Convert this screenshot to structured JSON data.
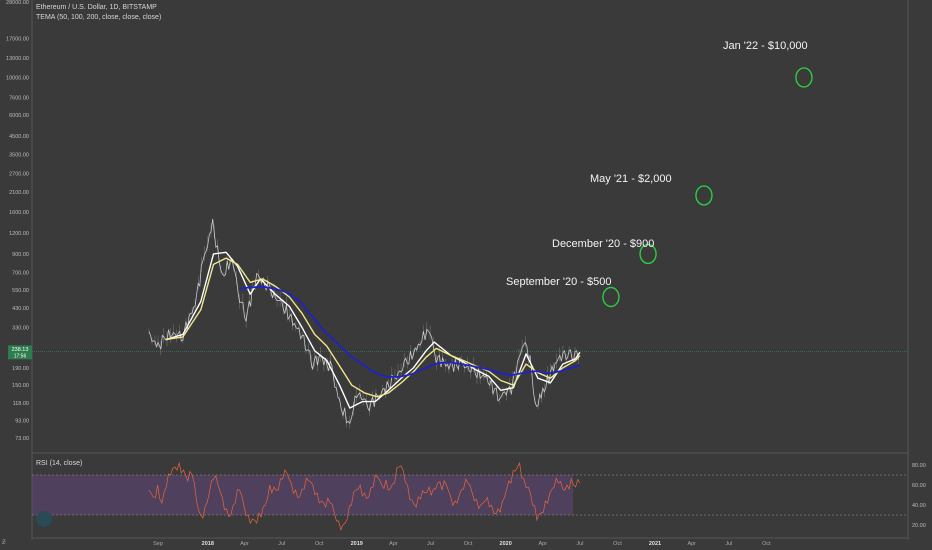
{
  "header": {
    "symbol": "Ethereum / U.S. Dollar, 1D, BITSTAMP",
    "indicator": "TEMA (50, 100, 200, close, close, close)"
  },
  "rsi": {
    "label": "RSI (14, close)"
  },
  "price_tag": {
    "value": "238.13",
    "countdown": "17:56"
  },
  "corner_glyph": "Ƶ",
  "annotations": [
    {
      "text": "Jan '22 - $10,000"
    },
    {
      "text": "May '21 - $2,000"
    },
    {
      "text": "December '20 - $900"
    },
    {
      "text": "September '20 - $500"
    }
  ],
  "colors": {
    "background": "#3a3a3a",
    "price_candles": "#e0e0e0",
    "tema_50": "#ffffff",
    "tema_100": "#f2e68a",
    "tema_200": "#1e22c8",
    "rsi_line": "#e8663a",
    "rsi_band": "#6a4a8a",
    "target_circles": "#2ecc40",
    "current_price_line": "#2e8b57"
  },
  "chart_data": [
    {
      "type": "line",
      "scale": "log",
      "y_ticks": [
        "28000.00",
        "17000.00",
        "13000.00",
        "10000.00",
        "7600.00",
        "6000.00",
        "4500.00",
        "3500.00",
        "2700.00",
        "2100.00",
        "1600.00",
        "1200.00",
        "900.00",
        "700.00",
        "550.00",
        "430.00",
        "330.00",
        "250.00",
        "190.00",
        "150.00",
        "118.00",
        "93.00",
        "73.00"
      ],
      "x_ticks": [
        "Sep",
        "2018",
        "Apr",
        "Jul",
        "Oct",
        "2019",
        "Apr",
        "Jul",
        "Oct",
        "2020",
        "Apr",
        "Jul",
        "Oct",
        "2021",
        "Apr",
        "Jul",
        "Oct"
      ],
      "series": [
        {
          "values_date": [
            "2017-08-10",
            "2017-09-01",
            "2017-09-15",
            "2017-10-01",
            "2017-11-01",
            "2017-12-01",
            "2017-12-20",
            "2018-01-13",
            "2018-02-06",
            "2018-03-01",
            "2018-03-20",
            "2018-04-05",
            "2018-05-01",
            "2018-06-01",
            "2018-07-01",
            "2018-08-01",
            "2018-09-01",
            "2018-09-15",
            "2018-10-01",
            "2018-11-01",
            "2018-11-20",
            "2018-12-15",
            "2019-01-01",
            "2019-02-01",
            "2019-03-01",
            "2019-04-01",
            "2019-05-01",
            "2019-06-01",
            "2019-06-26",
            "2019-07-15",
            "2019-08-15",
            "2019-09-15",
            "2019-10-15",
            "2019-11-15",
            "2019-12-17",
            "2020-01-15",
            "2020-02-14",
            "2020-03-01",
            "2020-03-13",
            "2020-04-01",
            "2020-05-01",
            "2020-06-01",
            "2020-06-15",
            "2020-07-01"
          ],
          "values": [
            300,
            250,
            280,
            300,
            300,
            460,
            800,
            1350,
            650,
            860,
            500,
            380,
            680,
            550,
            450,
            350,
            260,
            200,
            225,
            185,
            115,
            88,
            135,
            115,
            135,
            160,
            200,
            255,
            330,
            220,
            195,
            200,
            180,
            165,
            128,
            145,
            275,
            220,
            110,
            135,
            205,
            240,
            225,
            238
          ]
        },
        {
          "name": "TEMA 50",
          "x_date": [
            "2017-09-20",
            "2017-11-01",
            "2017-12-15",
            "2018-01-15",
            "2018-02-15",
            "2018-03-15",
            "2018-04-15",
            "2018-05-10",
            "2018-06-15",
            "2018-07-20",
            "2018-08-20",
            "2018-09-20",
            "2018-10-20",
            "2018-11-20",
            "2018-12-15",
            "2019-01-15",
            "2019-02-15",
            "2019-03-20",
            "2019-04-20",
            "2019-05-20",
            "2019-06-20",
            "2019-07-10",
            "2019-08-20",
            "2019-09-20",
            "2019-10-20",
            "2019-11-20",
            "2019-12-20",
            "2020-01-20",
            "2020-02-20",
            "2020-03-20",
            "2020-04-20",
            "2020-05-20",
            "2020-06-20",
            "2020-07-01"
          ],
          "y": [
            280,
            300,
            470,
            900,
            920,
            760,
            520,
            640,
            520,
            440,
            330,
            240,
            210,
            150,
            110,
            120,
            120,
            140,
            165,
            190,
            240,
            270,
            225,
            205,
            185,
            170,
            140,
            145,
            230,
            165,
            155,
            200,
            215,
            235
          ]
        },
        {
          "name": "TEMA 100",
          "x_date": [
            "2017-09-20",
            "2017-11-01",
            "2017-12-15",
            "2018-01-15",
            "2018-02-15",
            "2018-03-15",
            "2018-04-15",
            "2018-05-15",
            "2018-06-15",
            "2018-07-20",
            "2018-08-20",
            "2018-09-20",
            "2018-10-20",
            "2018-11-20",
            "2018-12-20",
            "2019-01-20",
            "2019-02-20",
            "2019-03-20",
            "2019-04-20",
            "2019-05-20",
            "2019-06-20",
            "2019-07-15",
            "2019-08-20",
            "2019-09-20",
            "2019-10-20",
            "2019-11-20",
            "2019-12-20",
            "2020-01-20",
            "2020-02-20",
            "2020-03-20",
            "2020-04-20",
            "2020-05-20",
            "2020-06-20",
            "2020-07-01"
          ],
          "y": [
            280,
            290,
            420,
            780,
            850,
            780,
            610,
            640,
            580,
            500,
            400,
            300,
            255,
            195,
            150,
            135,
            128,
            135,
            155,
            180,
            220,
            248,
            225,
            210,
            195,
            182,
            160,
            150,
            200,
            178,
            165,
            190,
            210,
            225
          ]
        },
        {
          "name": "TEMA 200",
          "x_date": [
            "2018-03-20",
            "2018-04-15",
            "2018-05-15",
            "2018-06-15",
            "2018-07-15",
            "2018-08-15",
            "2018-09-15",
            "2018-10-15",
            "2018-11-15",
            "2018-12-15",
            "2019-01-15",
            "2019-02-15",
            "2019-03-15",
            "2019-04-15",
            "2019-05-15",
            "2019-06-15",
            "2019-07-15",
            "2019-08-15",
            "2019-09-15",
            "2019-10-15",
            "2019-11-15",
            "2019-12-15",
            "2020-01-15",
            "2020-02-15",
            "2020-03-15",
            "2020-04-15",
            "2020-05-15",
            "2020-06-15",
            "2020-07-01"
          ],
          "y": [
            560,
            570,
            575,
            560,
            530,
            470,
            380,
            310,
            265,
            225,
            200,
            178,
            168,
            168,
            174,
            188,
            202,
            205,
            200,
            194,
            187,
            178,
            172,
            178,
            182,
            176,
            182,
            192,
            198
          ]
        }
      ]
    },
    {
      "type": "line",
      "name": "RSI (14, close)",
      "y_ticks": [
        "80.00",
        "60.00",
        "40.00",
        "20.00"
      ],
      "band": [
        30,
        70
      ],
      "x_date_range": [
        "2017-08-10",
        "2020-07-01"
      ],
      "values": [
        55,
        48,
        60,
        42,
        58,
        70,
        78,
        82,
        75,
        64,
        70,
        45,
        30,
        38,
        52,
        66,
        60,
        48,
        36,
        30,
        42,
        55,
        40,
        30,
        26,
        22,
        28,
        40,
        60,
        58,
        55,
        66,
        72,
        62,
        55,
        48,
        56,
        64,
        60,
        52,
        44,
        38,
        42,
        32,
        24,
        20,
        26,
        40,
        55,
        60,
        52,
        48,
        58,
        68,
        60,
        65,
        56,
        62,
        78,
        74,
        60,
        45,
        38,
        46,
        52,
        58,
        56,
        62,
        55,
        60,
        48,
        44,
        50,
        56,
        62,
        52,
        46,
        40,
        44,
        38,
        32,
        36,
        44,
        56,
        62,
        74,
        82,
        66,
        58,
        40,
        25,
        32,
        44,
        52,
        58,
        62,
        56,
        60,
        66,
        58,
        62
      ]
    }
  ]
}
